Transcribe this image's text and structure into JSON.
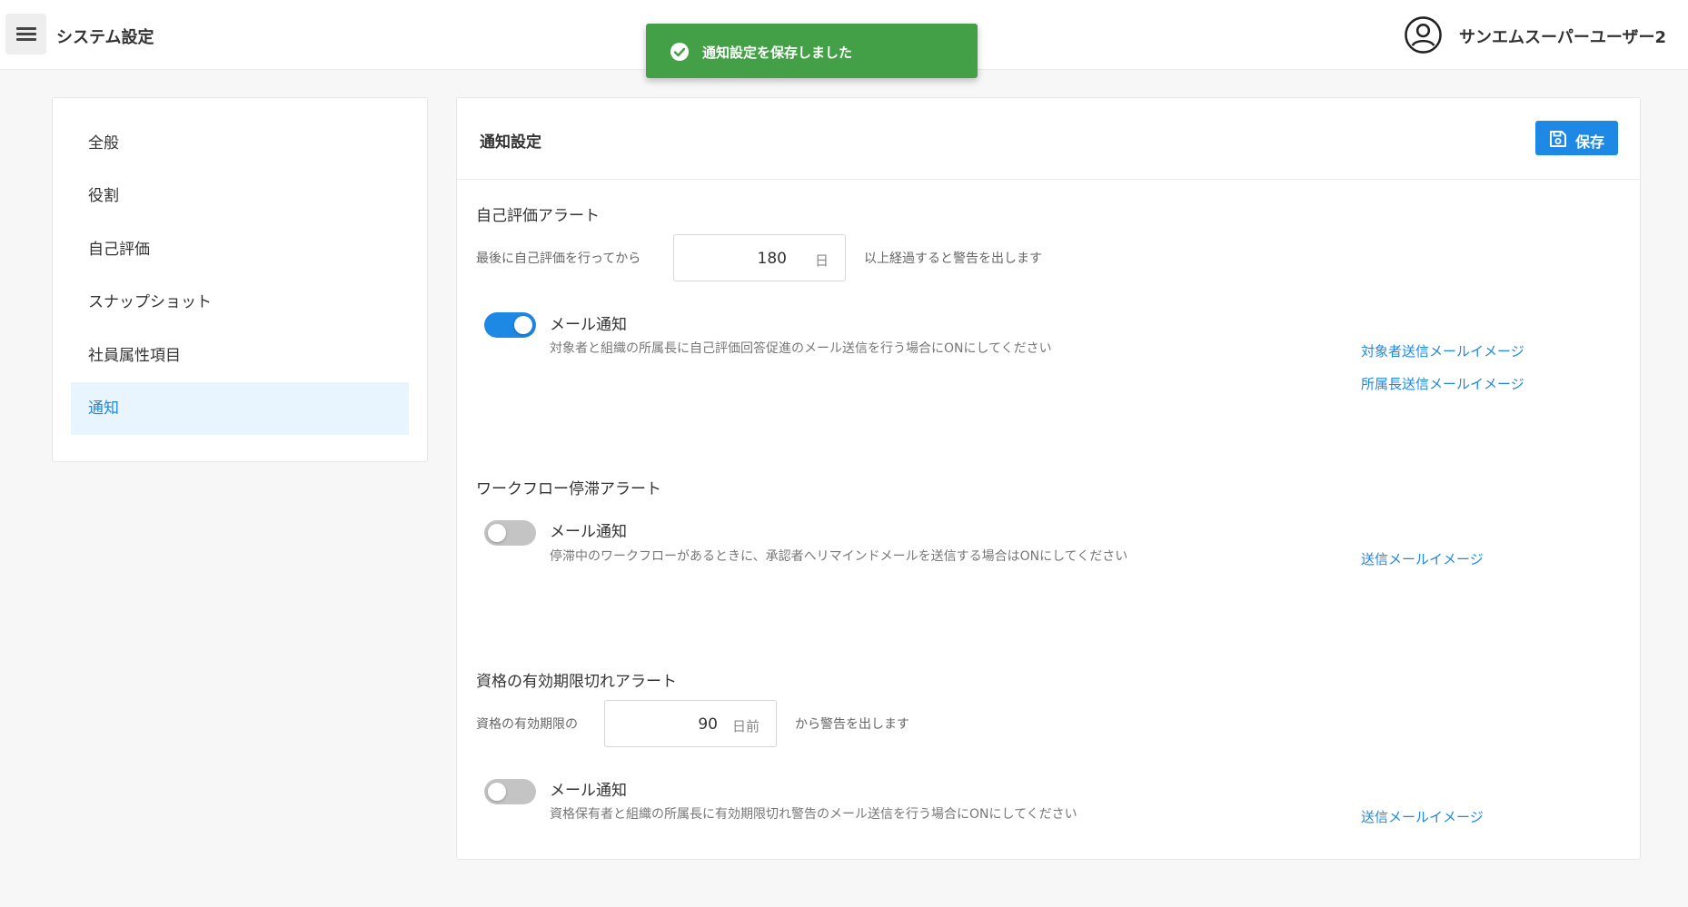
{
  "header": {
    "app_title": "システム設定",
    "user_name": "サンエムスーパーユーザー2"
  },
  "toast": {
    "message": "通知設定を保存しました"
  },
  "sidebar": {
    "items": [
      {
        "label": "全般"
      },
      {
        "label": "役割"
      },
      {
        "label": "自己評価"
      },
      {
        "label": "スナップショット"
      },
      {
        "label": "社員属性項目"
      },
      {
        "label": "通知",
        "active": true
      }
    ]
  },
  "main": {
    "title": "通知設定",
    "save_label": "保存",
    "self_eval_alert": {
      "title": "自己評価アラート",
      "prefix": "最後に自己評価を行ってから",
      "days_value": "180",
      "days_unit": "日",
      "suffix": "以上経過すると警告を出します",
      "mail_title": "メール通知",
      "mail_enabled": true,
      "mail_desc": "対象者と組織の所属長に自己評価回答促進のメール送信を行う場合にONにしてください",
      "link_target": "対象者送信メールイメージ",
      "link_manager": "所属長送信メールイメージ"
    },
    "workflow_alert": {
      "title": "ワークフロー停滞アラート",
      "mail_title": "メール通知",
      "mail_enabled": false,
      "mail_desc": "停滞中のワークフローがあるときに、承認者へリマインドメールを送信する場合はONにしてください",
      "link": "送信メールイメージ"
    },
    "qualification_alert": {
      "title": "資格の有効期限切れアラート",
      "prefix": "資格の有効期限の",
      "days_value": "90",
      "days_unit": "日前",
      "suffix": "から警告を出します",
      "mail_title": "メール通知",
      "mail_enabled": false,
      "mail_desc": "資格保有者と組織の所属長に有効期限切れ警告のメール送信を行う場合にONにしてください",
      "link": "送信メールイメージ"
    }
  },
  "colors": {
    "primary": "#1e88e5",
    "toast_green": "#43a047",
    "toggle_off": "#c4c4c4",
    "active_bg": "#e8f4fe"
  }
}
